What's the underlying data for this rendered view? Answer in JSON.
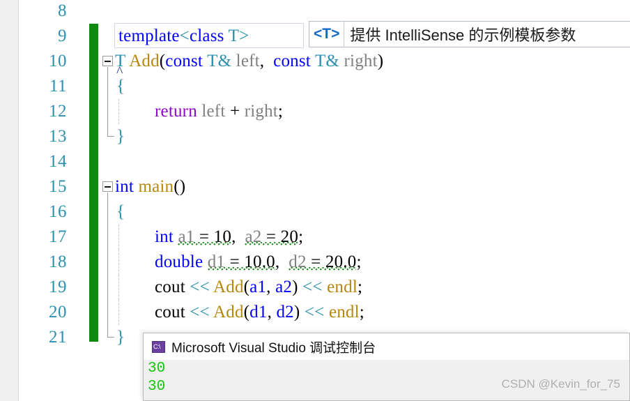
{
  "editor": {
    "language": "cpp",
    "gutter": {
      "change_bar_color": "#108a10"
    },
    "lines": [
      {
        "number": "8",
        "text": ""
      },
      {
        "number": "9",
        "text": "template<class T>"
      },
      {
        "number": "10",
        "text": "T Add(const T& left, const T& right)"
      },
      {
        "number": "11",
        "text": "{"
      },
      {
        "number": "12",
        "text": "    return left + right;"
      },
      {
        "number": "13",
        "text": "}"
      },
      {
        "number": "14",
        "text": ""
      },
      {
        "number": "15",
        "text": "int main()"
      },
      {
        "number": "16",
        "text": "{"
      },
      {
        "number": "17",
        "text": "    int a1 = 10, a2 = 20;"
      },
      {
        "number": "18",
        "text": "    double d1 = 10.0, d2 = 20.0;"
      },
      {
        "number": "19",
        "text": "    cout << Add(a1, a2) << endl;"
      },
      {
        "number": "20",
        "text": "    cout << Add(d1, d2) << endl;"
      },
      {
        "number": "21",
        "text": "}"
      }
    ],
    "tokens": {
      "kw_template": "template",
      "angle_open": "<",
      "kw_class": "class",
      "type_T": "T",
      "angle_close": ">",
      "fn_Add": "Add",
      "kw_const": "const",
      "amp": "&",
      "ident_left": "left",
      "ident_right": "right",
      "kw_return": "return",
      "op_plus": "+",
      "kw_int": "int",
      "kw_double": "double",
      "fn_main": "main",
      "ident_cout": "cout",
      "ident_endl": "endl",
      "op_shift": "<<",
      "ident_a1": "a1",
      "ident_a2": "a2",
      "ident_d1": "d1",
      "ident_d2": "d2",
      "num_10": "10",
      "num_20": "20",
      "num_10_0": "10.0",
      "num_20_0": "20.0",
      "brace_open": "{",
      "brace_close": "}",
      "paren_open": "(",
      "paren_close": ")",
      "comma": ",",
      "semi": ";",
      "eq": "="
    }
  },
  "tooltip": {
    "param": "<T>",
    "description": "提供 IntelliSense 的示例模板参数",
    "border_color": "#b4bcd0",
    "param_color": "#1569c7"
  },
  "console": {
    "title": "Microsoft Visual Studio 调试控制台",
    "icon": "cmd-console-icon",
    "icon_label": "C:\\",
    "output_lines": [
      "30",
      "30"
    ],
    "output_color": "#16c60c"
  },
  "watermark": {
    "text": "CSDN @Kevin_for_75"
  }
}
